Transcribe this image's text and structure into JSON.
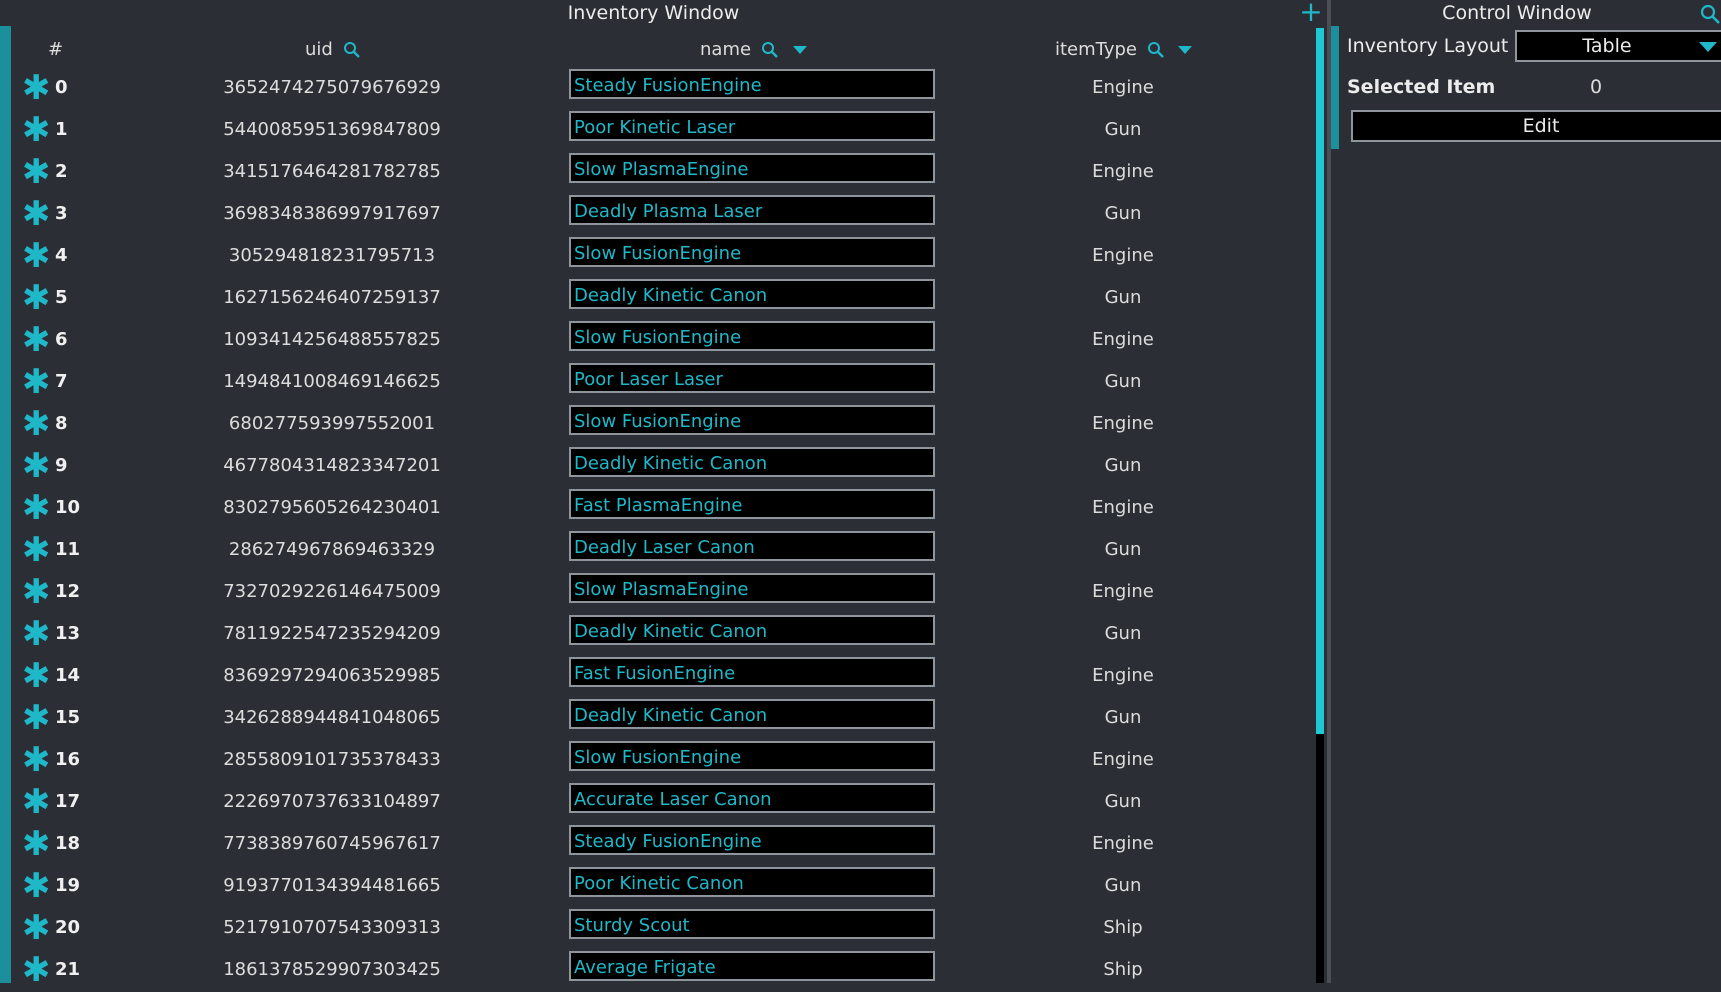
{
  "inventory_window": {
    "title": "Inventory Window",
    "add_icon": "plus-icon",
    "columns": {
      "num": "#",
      "uid": "uid",
      "name": "name",
      "item_type": "itemType"
    },
    "rows": [
      {
        "num": "0",
        "uid": "3652474275079676929",
        "name": "Steady FusionEngine",
        "type": "Engine"
      },
      {
        "num": "1",
        "uid": "5440085951369847809",
        "name": "Poor Kinetic Laser",
        "type": "Gun"
      },
      {
        "num": "2",
        "uid": "3415176464281782785",
        "name": "Slow PlasmaEngine",
        "type": "Engine"
      },
      {
        "num": "3",
        "uid": "3698348386997917697",
        "name": "Deadly Plasma Laser",
        "type": "Gun"
      },
      {
        "num": "4",
        "uid": "305294818231795713",
        "name": "Slow FusionEngine",
        "type": "Engine"
      },
      {
        "num": "5",
        "uid": "1627156246407259137",
        "name": "Deadly Kinetic Canon",
        "type": "Gun"
      },
      {
        "num": "6",
        "uid": "1093414256488557825",
        "name": "Slow FusionEngine",
        "type": "Engine"
      },
      {
        "num": "7",
        "uid": "1494841008469146625",
        "name": "Poor Laser Laser",
        "type": "Gun"
      },
      {
        "num": "8",
        "uid": "680277593997552001",
        "name": "Slow FusionEngine",
        "type": "Engine"
      },
      {
        "num": "9",
        "uid": "4677804314823347201",
        "name": "Deadly Kinetic Canon",
        "type": "Gun"
      },
      {
        "num": "10",
        "uid": "8302795605264230401",
        "name": "Fast PlasmaEngine",
        "type": "Engine"
      },
      {
        "num": "11",
        "uid": "286274967869463329",
        "name": "Deadly Laser Canon",
        "type": "Gun"
      },
      {
        "num": "12",
        "uid": "7327029226146475009",
        "name": "Slow PlasmaEngine",
        "type": "Engine"
      },
      {
        "num": "13",
        "uid": "7811922547235294209",
        "name": "Deadly Kinetic Canon",
        "type": "Gun"
      },
      {
        "num": "14",
        "uid": "8369297294063529985",
        "name": "Fast FusionEngine",
        "type": "Engine"
      },
      {
        "num": "15",
        "uid": "3426288944841048065",
        "name": "Deadly Kinetic Canon",
        "type": "Gun"
      },
      {
        "num": "16",
        "uid": "2855809101735378433",
        "name": "Slow FusionEngine",
        "type": "Engine"
      },
      {
        "num": "17",
        "uid": "2226970737633104897",
        "name": "Accurate Laser Canon",
        "type": "Gun"
      },
      {
        "num": "18",
        "uid": "7738389760745967617",
        "name": "Steady FusionEngine",
        "type": "Engine"
      },
      {
        "num": "19",
        "uid": "9193770134394481665",
        "name": "Poor Kinetic Canon",
        "type": "Gun"
      },
      {
        "num": "20",
        "uid": "5217910707543309313",
        "name": "Sturdy Scout",
        "type": "Ship"
      },
      {
        "num": "21",
        "uid": "1861378529907303425",
        "name": "Average Frigate",
        "type": "Ship"
      }
    ]
  },
  "control_window": {
    "title": "Control Window",
    "layout_label": "Inventory Layout",
    "layout_value": "Table",
    "selected_label": "Selected Item",
    "selected_value": "0",
    "edit_label": "Edit"
  },
  "colors": {
    "accent": "#1fb8c9",
    "background": "#2b2f35",
    "field": "#000000"
  }
}
